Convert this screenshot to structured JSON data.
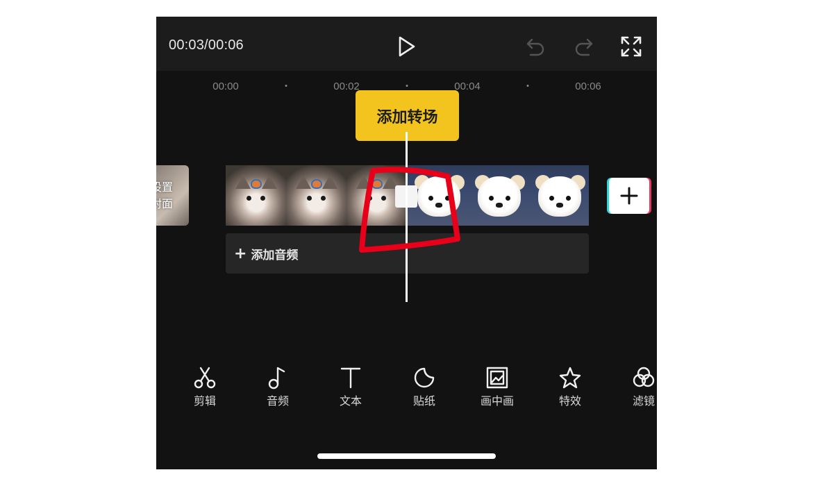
{
  "header": {
    "timecode": "00:03/00:06",
    "play_icon": "play-icon",
    "undo_icon": "undo-icon",
    "redo_icon": "redo-icon",
    "fullscreen_icon": "fullscreen-icon"
  },
  "ruler": {
    "ticks": [
      "00:00",
      "00:02",
      "00:04",
      "00:06"
    ]
  },
  "timeline": {
    "tooltip": "添加转场",
    "cover_line1": "设置",
    "cover_line2": "封面",
    "add_audio": "添加音频",
    "add_audio_plus": "+",
    "add_clip_icon": "plus-icon"
  },
  "toolbar": {
    "items": [
      {
        "label": "剪辑",
        "icon": "scissors-icon"
      },
      {
        "label": "音频",
        "icon": "music-note-icon"
      },
      {
        "label": "文本",
        "icon": "text-icon"
      },
      {
        "label": "贴纸",
        "icon": "sticker-icon"
      },
      {
        "label": "画中画",
        "icon": "picture-in-picture-icon"
      },
      {
        "label": "特效",
        "icon": "star-effect-icon"
      },
      {
        "label": "滤镜",
        "icon": "filter-icon"
      }
    ]
  },
  "colors": {
    "background": "#121212",
    "topbar": "#1c1c1c",
    "accent_yellow": "#f2c41d",
    "annotation_red": "#e8001a"
  }
}
